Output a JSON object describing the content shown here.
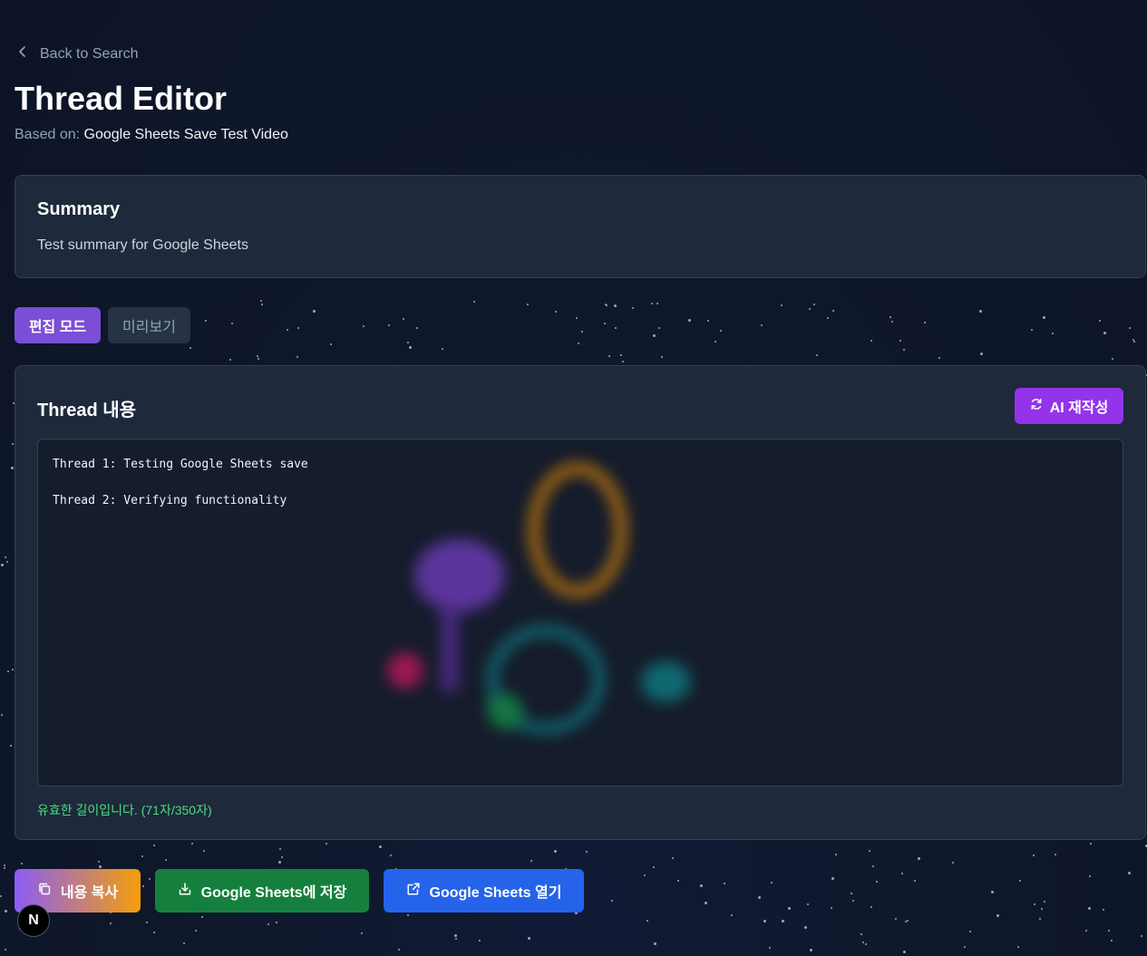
{
  "nav": {
    "back_label": "Back to Search"
  },
  "header": {
    "title": "Thread Editor",
    "based_on_label": "Based on:",
    "based_on_value": "Google Sheets Save Test Video"
  },
  "summary": {
    "heading": "Summary",
    "text": "Test summary for Google Sheets"
  },
  "modes": {
    "edit_label": "편집 모드",
    "preview_label": "미리보기",
    "active": "edit"
  },
  "editor": {
    "heading": "Thread 내용",
    "ai_button_label": "AI 재작성",
    "lines": [
      "Thread 1: Testing Google Sheets save",
      "",
      "Thread 2: Verifying functionality"
    ],
    "validation": "유효한 길이입니다. (71자/350자)"
  },
  "actions": {
    "copy_label": "내용 복사",
    "save_label": "Google Sheets에 저장",
    "open_label": "Google Sheets 열기"
  },
  "badge": {
    "letter": "N"
  },
  "colors": {
    "background": "#0f172a",
    "card": "#1e293b",
    "edit_mode": "#7c4dd6",
    "ai_button": "#9333ea",
    "save_button": "#15803d",
    "open_button": "#2563eb",
    "validation": "#4ade80"
  },
  "icons": {
    "back": "chevron-left-icon",
    "ai": "refresh-icon",
    "copy": "copy-icon",
    "save": "download-icon",
    "open": "external-link-icon"
  }
}
